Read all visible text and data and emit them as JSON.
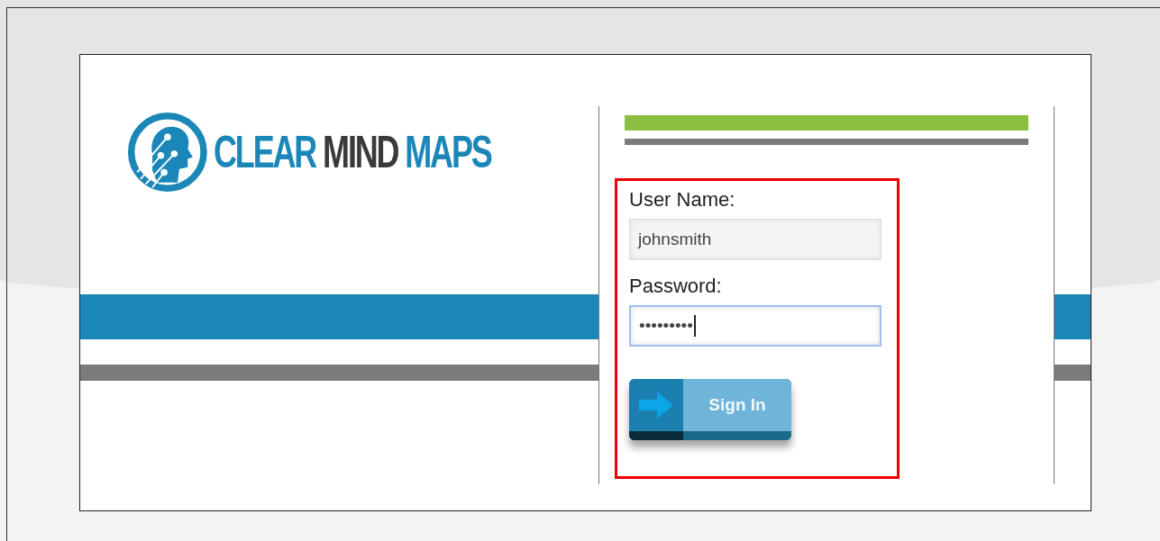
{
  "logo": {
    "words": [
      {
        "text": "CLEAR",
        "color": "#1b87b8"
      },
      {
        "text": "MIND",
        "color": "#3a3a3a"
      },
      {
        "text": "MAPS",
        "color": "#1b87b8"
      }
    ]
  },
  "form": {
    "highlighted": true,
    "fields": [
      {
        "label": "User Name:",
        "value": "johnsmith",
        "focused": false
      },
      {
        "label": "Password:",
        "value": "•••••••••",
        "focused": true
      }
    ],
    "button": "Sign In"
  }
}
